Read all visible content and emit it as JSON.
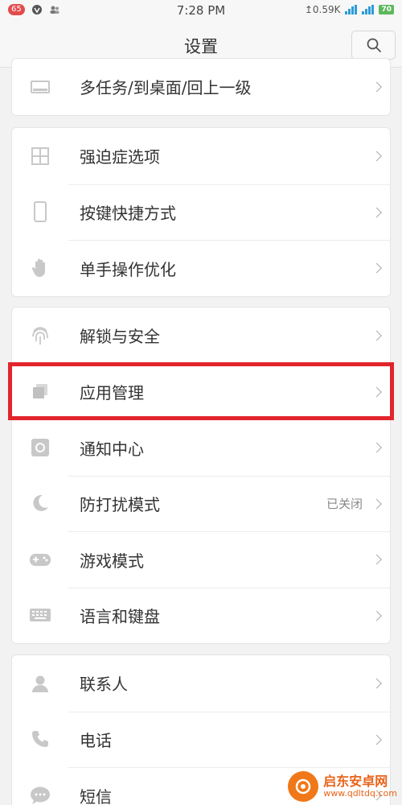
{
  "statusbar": {
    "badge": "65",
    "time": "7:28 PM",
    "net_speed": "↥0.59K",
    "battery": "70"
  },
  "header": {
    "title": "设置"
  },
  "groups": [
    {
      "items": [
        {
          "label": "多任务/到桌面/回上一级",
          "icon": "multitask-icon"
        }
      ]
    },
    {
      "items": [
        {
          "label": "强迫症选项",
          "icon": "grid-icon"
        },
        {
          "label": "按键快捷方式",
          "icon": "phone-outline-icon"
        },
        {
          "label": "单手操作优化",
          "icon": "hand-icon"
        }
      ]
    },
    {
      "items": [
        {
          "label": "解锁与安全",
          "icon": "fingerprint-icon"
        },
        {
          "label": "应用管理",
          "icon": "app-manage-icon"
        },
        {
          "label": "通知中心",
          "icon": "notification-icon"
        },
        {
          "label": "防打扰模式",
          "icon": "moon-icon",
          "value": "已关闭"
        },
        {
          "label": "游戏模式",
          "icon": "gamepad-icon"
        },
        {
          "label": "语言和键盘",
          "icon": "keyboard-icon"
        }
      ]
    },
    {
      "items": [
        {
          "label": "联系人",
          "icon": "contact-icon"
        },
        {
          "label": "电话",
          "icon": "phone-icon"
        },
        {
          "label": "短信",
          "icon": "message-icon"
        }
      ]
    }
  ],
  "highlighted_item": "应用管理",
  "watermark": {
    "title": "启东安卓网",
    "url": "www.qdltdq.com"
  },
  "colors": {
    "highlight": "#e2242c",
    "icon": "#c8c8c8",
    "background": "#f2f2f2"
  }
}
